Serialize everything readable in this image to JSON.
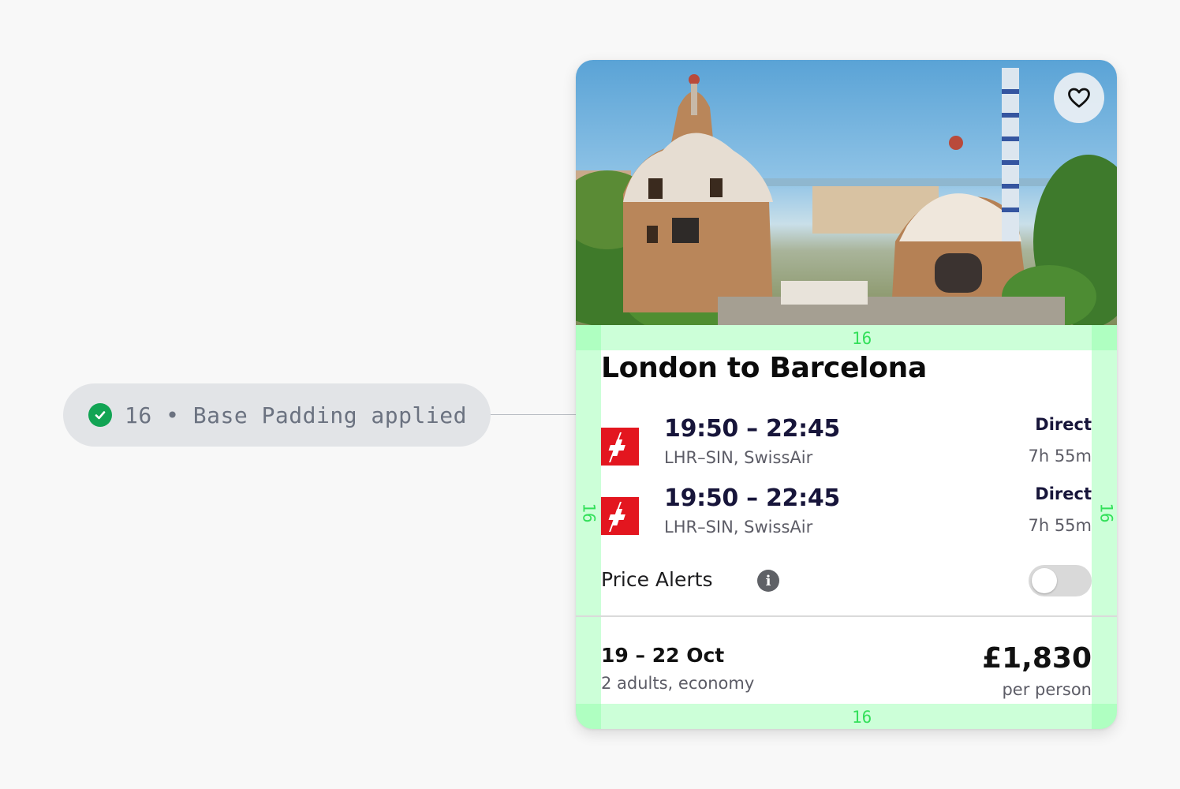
{
  "annotation": {
    "icon": "check-circle-icon",
    "text": "16 • Base Padding applied",
    "check_color": "#12a454"
  },
  "card": {
    "image_alt": "Park Güell, Barcelona",
    "favourite_icon": "heart-icon",
    "title": "London to Barcelona",
    "flights": [
      {
        "airline_icon": "swissair-logo-icon",
        "times": "19:50 – 22:45",
        "route": "LHR–SIN, SwissAir",
        "stops": "Direct",
        "duration": "7h 55m"
      },
      {
        "airline_icon": "swissair-logo-icon",
        "times": "19:50 – 22:45",
        "route": "LHR–SIN, SwissAir",
        "stops": "Direct",
        "duration": "7h 55m"
      }
    ],
    "price_alerts": {
      "label": "Price Alerts",
      "info_icon": "info-icon",
      "enabled": false
    },
    "trip": {
      "dates": "19 – 22 Oct",
      "passengers": "2 adults, economy",
      "price": "£1,830",
      "price_unit": "per person"
    }
  },
  "padding_labels": {
    "top": "16",
    "bottom": "16",
    "left": "16",
    "right": "16"
  },
  "colors": {
    "padding_overlay": "#33e05a",
    "airline_red": "#e3161f",
    "text_dark": "#17153a"
  }
}
